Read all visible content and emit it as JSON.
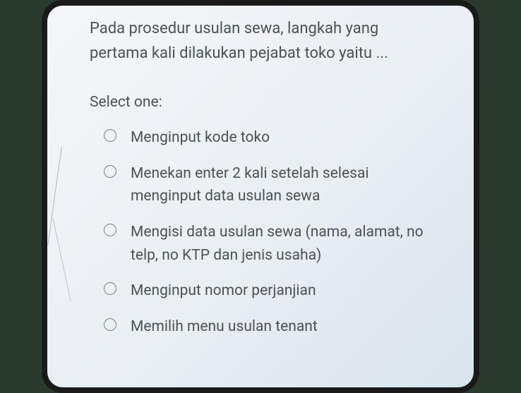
{
  "question": {
    "text": "Pada prosedur usulan sewa, langkah yang pertama kali dilakukan pejabat toko yaitu ..."
  },
  "select_label": "Select one:",
  "options": [
    {
      "text": "Menginput kode toko"
    },
    {
      "text": "Menekan enter 2 kali setelah selesai menginput data usulan sewa"
    },
    {
      "text": "Mengisi data usulan sewa (nama, alamat, no telp, no KTP dan jenis usaha)"
    },
    {
      "text": "Menginput nomor perjanjian"
    },
    {
      "text": "Memilih menu usulan tenant"
    }
  ]
}
